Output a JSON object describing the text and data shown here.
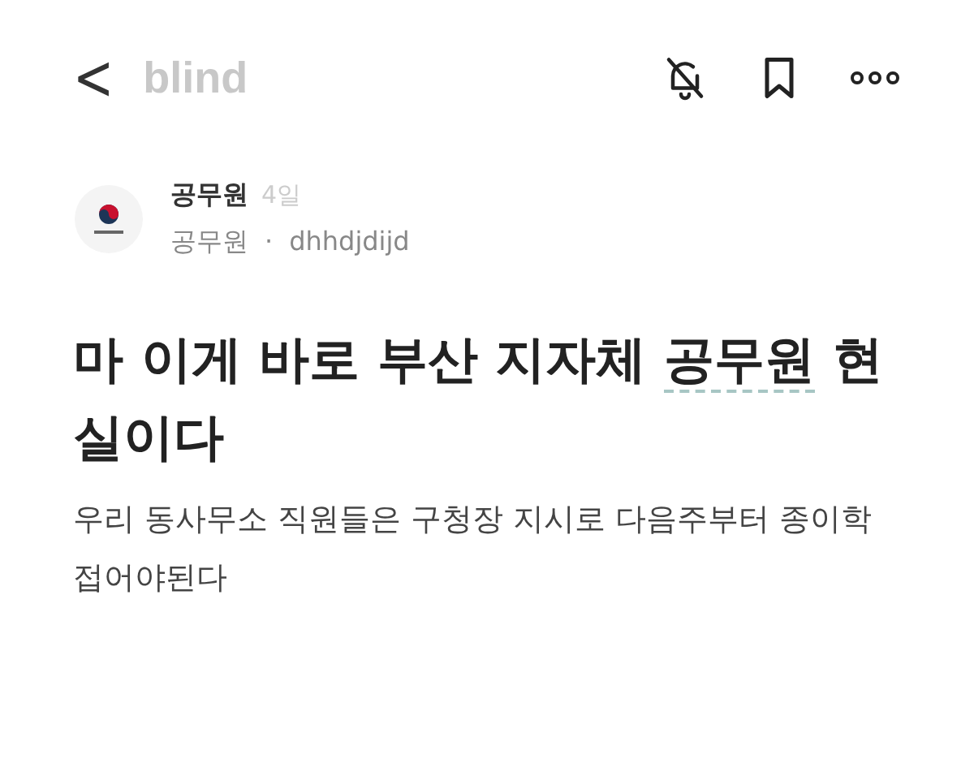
{
  "header": {
    "back": "<",
    "brand": "blind"
  },
  "post": {
    "author": "공무원",
    "time": "4일",
    "company": "공무원",
    "separator": "·",
    "username": "dhhdjdijd",
    "title": [
      {
        "text": "마 이게 바로 부산 지자체 ",
        "dashed": false
      },
      {
        "text": "공무원",
        "dashed": true
      },
      {
        "text": " 현실이다",
        "dashed": false
      }
    ],
    "body": "우리 동사무소 직원들은 구청장 지시로 다음주부터 종이학 접어야된다"
  }
}
